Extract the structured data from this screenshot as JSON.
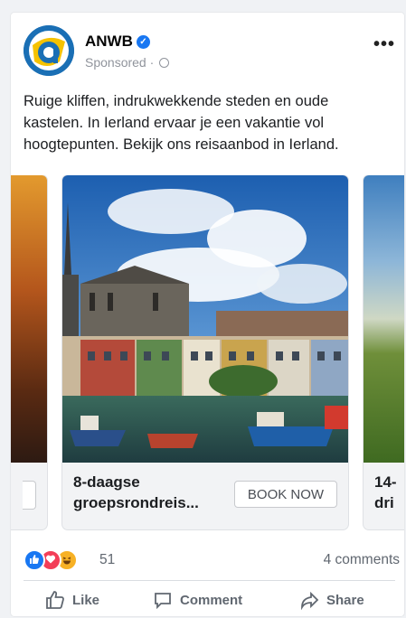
{
  "post": {
    "page_name": "ANWB",
    "sponsored_label": "Sponsored ·",
    "more_label": "•••",
    "text": "Ruige kliffen, indrukwekkende steden en oude kastelen. In Ierland ervaar je een vakantie vol hoogtepunten. Bekijk ons reisaanbod in Ierland."
  },
  "carousel": {
    "center": {
      "caption": "8-daagse groepsrondreis...",
      "button": "BOOK NOW"
    },
    "right": {
      "caption_partial": "14-\ndri"
    }
  },
  "stats": {
    "reaction_count": "51",
    "comments": "4 comments"
  },
  "actions": {
    "like": "Like",
    "comment": "Comment",
    "share": "Share"
  },
  "colors": {
    "brand_blue": "#1a6fb5",
    "facebook_blue": "#1877f2"
  },
  "icons": {
    "avatar": "anwb-logo-icon",
    "verified": "verified-badge-icon",
    "audience": "globe-icon",
    "reactions": [
      "like-reaction-icon",
      "love-reaction-icon",
      "haha-reaction-icon"
    ],
    "actions": [
      "thumbs-up-icon",
      "comment-bubble-icon",
      "share-arrow-icon"
    ]
  }
}
